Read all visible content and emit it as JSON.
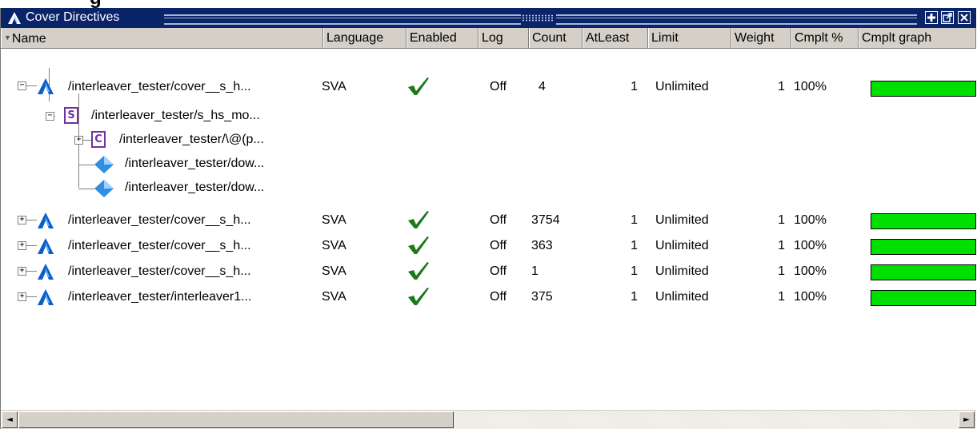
{
  "window": {
    "title": "Cover Directives",
    "top_cropped_text": "g"
  },
  "columns": {
    "name": "Name",
    "language": "Language",
    "enabled": "Enabled",
    "log": "Log",
    "count": "Count",
    "atleast": "AtLeast",
    "limit": "Limit",
    "weight": "Weight",
    "cmplt_pct": "Cmplt %",
    "cmplt_graph": "Cmplt graph"
  },
  "rows": [
    {
      "name": "/interleaver_tester/cover__s_h...",
      "language": "SVA",
      "enabled": true,
      "log": "Off",
      "count": "4",
      "atleast": "1",
      "limit": "Unlimited",
      "weight": "1",
      "cmplt_pct": "100%",
      "cmplt_fraction": 1.0
    },
    {
      "name": "/interleaver_tester/s_hs_mo...",
      "badge": "S"
    },
    {
      "name": "/interleaver_tester/\\@(p...",
      "badge": "C"
    },
    {
      "name": "/interleaver_tester/dow..."
    },
    {
      "name": "/interleaver_tester/dow..."
    },
    {
      "name": "/interleaver_tester/cover__s_h...",
      "language": "SVA",
      "enabled": true,
      "log": "Off",
      "count": "3754",
      "atleast": "1",
      "limit": "Unlimited",
      "weight": "1",
      "cmplt_pct": "100%",
      "cmplt_fraction": 1.0
    },
    {
      "name": "/interleaver_tester/cover__s_h...",
      "language": "SVA",
      "enabled": true,
      "log": "Off",
      "count": "363",
      "atleast": "1",
      "limit": "Unlimited",
      "weight": "1",
      "cmplt_pct": "100%",
      "cmplt_fraction": 1.0
    },
    {
      "name": "/interleaver_tester/cover__s_h...",
      "language": "SVA",
      "enabled": true,
      "log": "Off",
      "count": "1",
      "atleast": "1",
      "limit": "Unlimited",
      "weight": "1",
      "cmplt_pct": "100%",
      "cmplt_fraction": 1.0
    },
    {
      "name": "/interleaver_tester/interleaver1...",
      "language": "SVA",
      "enabled": true,
      "log": "Off",
      "count": "375",
      "atleast": "1",
      "limit": "Unlimited",
      "weight": "1",
      "cmplt_pct": "100%",
      "cmplt_fraction": 1.0
    }
  ],
  "icons": {
    "directive": "cover-directive-icon",
    "sequence": "sequence-icon",
    "cover": "cover-icon",
    "signal": "diamond-signal-icon",
    "enabled": "checkmark-icon"
  },
  "colors": {
    "titlebar": "#0a246a",
    "bar_fill": "#00e000",
    "check": "#1a7a1a",
    "badge": "#7030a0"
  },
  "expanders": {
    "collapsed": "+",
    "expanded": "−"
  },
  "scroll": {
    "left_arrow": "◄",
    "right_arrow": "►"
  }
}
